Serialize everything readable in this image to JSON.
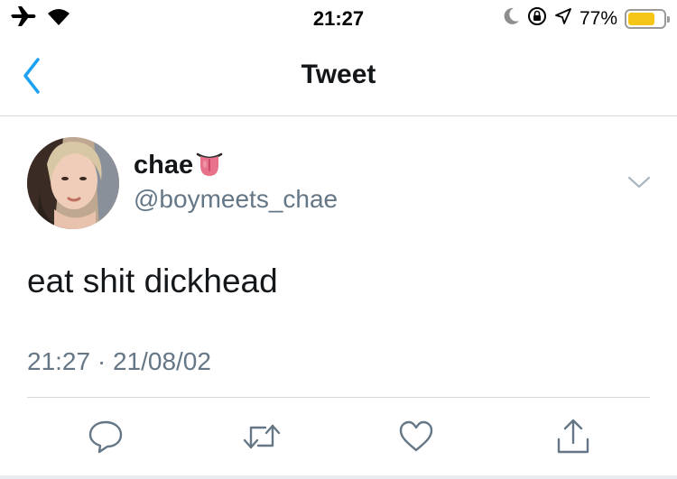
{
  "status_bar": {
    "time": "21:27",
    "battery_percent": "77%",
    "battery_level": 0.77,
    "icons": [
      "airplane-icon",
      "wifi-icon",
      "moon-icon",
      "rotation-lock-icon",
      "location-icon",
      "battery-icon"
    ]
  },
  "nav": {
    "title": "Tweet",
    "back_icon": "chevron-left-icon"
  },
  "tweet": {
    "display_name": "chae",
    "name_emoji": "tongue-emoji",
    "handle": "@boymeets_chae",
    "text": "eat shit dickhead",
    "timestamp": "21:27 · 21/08/02"
  },
  "actions": [
    "reply-icon",
    "retweet-icon",
    "like-icon",
    "share-icon"
  ],
  "colors": {
    "accent": "#1da1f2",
    "text_primary": "#14171a",
    "text_secondary": "#657786",
    "divider": "#d6d9dc",
    "battery": "#f5c518"
  }
}
